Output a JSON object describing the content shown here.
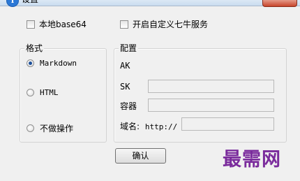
{
  "window": {
    "title": "设置"
  },
  "options": {
    "base64_label": "本地base64",
    "qiniu_label": "开启自定义七牛服务"
  },
  "format_group": {
    "title": "格式",
    "items": [
      {
        "label": "Markdown",
        "checked": true
      },
      {
        "label": "HTML",
        "checked": false
      },
      {
        "label": "不做操作",
        "checked": false
      }
    ]
  },
  "config_group": {
    "title": "配置",
    "ak_label": "AK",
    "sk_label": "SK",
    "bucket_label": "容器",
    "domain_label": "域名:",
    "domain_prefix": "http://"
  },
  "ok_label": "确认",
  "watermark": "最需网"
}
